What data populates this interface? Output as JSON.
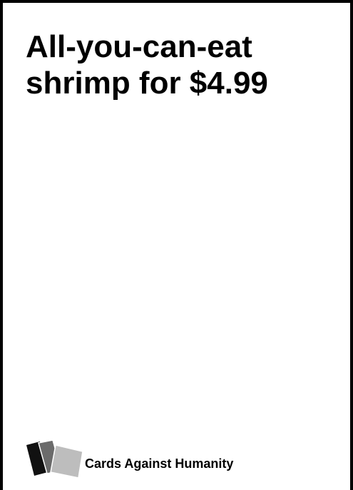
{
  "card": {
    "text": "All-you-can-eat\nshrimp for $4.99",
    "brand_name": "Cards Against Humanity"
  },
  "logo": {
    "icon_name": "cards-stack-icon",
    "card_colors": [
      "#111111",
      "#6b6b6b",
      "#bdbdbd"
    ]
  }
}
